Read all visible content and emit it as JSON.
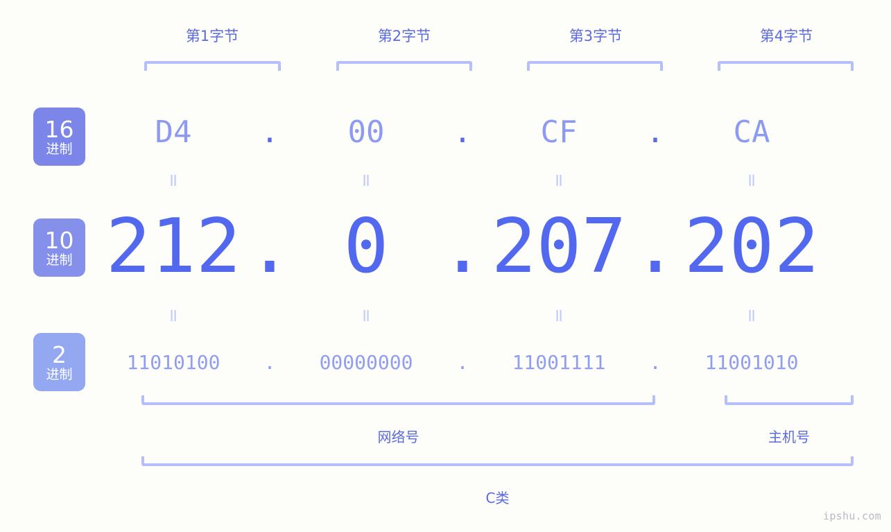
{
  "background_color": "#fdfefa",
  "accent_colors": {
    "bracket": "#b6bffb",
    "label_text": "#5b6ae0",
    "hex_text": "#8d9af2",
    "dec_text": "#5268ee",
    "bin_text": "#919dee",
    "equals": "#c3cbfb",
    "badge_hex": "#7b86e8",
    "badge_dec": "#8590ea",
    "badge_bin": "#93a8f0",
    "watermark": "#b9b8c6"
  },
  "byte_headers": [
    {
      "label": "第1字节"
    },
    {
      "label": "第2字节"
    },
    {
      "label": "第3字节"
    },
    {
      "label": "第4字节"
    }
  ],
  "badges": [
    {
      "num": "16",
      "unit": "进制"
    },
    {
      "num": "10",
      "unit": "进制"
    },
    {
      "num": "2",
      "unit": "进制"
    }
  ],
  "separator": ".",
  "equals_symbol": "=",
  "rows": {
    "hex": {
      "values": [
        "D4",
        "00",
        "CF",
        "CA"
      ]
    },
    "decimal": {
      "values": [
        "212",
        "0",
        "207",
        "202"
      ]
    },
    "binary": {
      "values": [
        "11010100",
        "00000000",
        "11001111",
        "11001010"
      ]
    }
  },
  "groups": {
    "network": {
      "label": "网络号"
    },
    "host": {
      "label": "主机号"
    },
    "class": {
      "label": "C类"
    }
  },
  "watermark": "ipshu.com"
}
